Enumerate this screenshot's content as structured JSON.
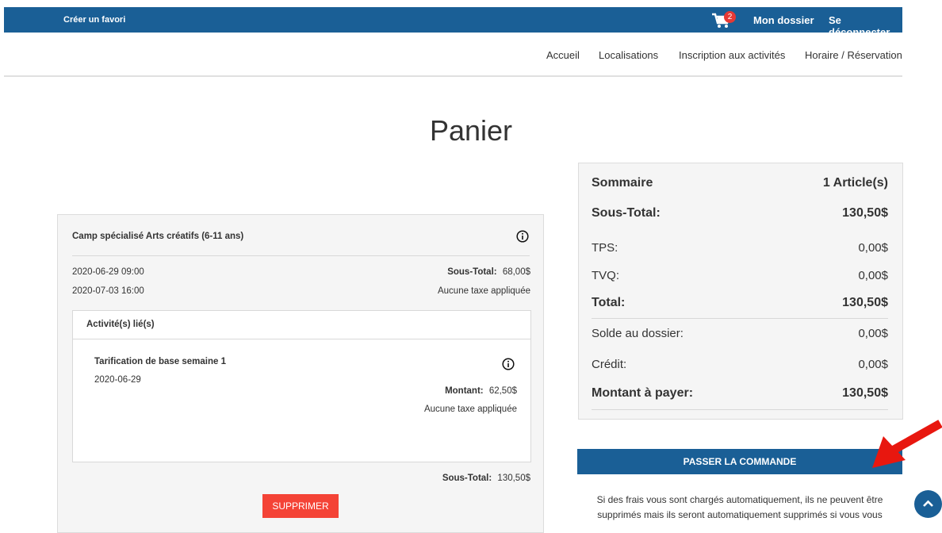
{
  "topbar": {
    "bookmark_label": "Créer un favori",
    "cart_count": "2",
    "my_account": "Mon dossier",
    "logout": "Se déconnecter"
  },
  "nav": {
    "items": [
      "Accueil",
      "Localisations",
      "Inscription aux activités",
      "Horaire / Réservation"
    ]
  },
  "page_title": "Panier",
  "cart_item": {
    "title": "Camp spécialisé Arts créatifs (6-11 ans)",
    "start": "2020-06-29 09:00",
    "end": "2020-07-03 16:00",
    "subtotal_label": "Sous-Total:",
    "subtotal_value": "68,00$",
    "tax_note": "Aucune taxe appliquée",
    "linked_header": "Activité(s) lié(s)",
    "linked": {
      "title": "Tarification de base semaine 1",
      "date": "2020-06-29",
      "amount_label": "Montant:",
      "amount_value": "62,50$",
      "tax_note": "Aucune taxe appliquée"
    },
    "total_label": "Sous-Total:",
    "total_value": "130,50$",
    "delete_label": "SUPPRIMER"
  },
  "summary": {
    "rows": [
      {
        "label": "Sommaire",
        "value": "1 Article(s)"
      },
      {
        "label": "Sous-Total:",
        "value": "130,50$"
      },
      {
        "label": "TPS:",
        "value": "0,00$"
      },
      {
        "label": "TVQ:",
        "value": "0,00$"
      },
      {
        "label": "Total:",
        "value": "130,50$"
      },
      {
        "label": "Solde au dossier:",
        "value": "0,00$"
      },
      {
        "label": "Crédit:",
        "value": "0,00$"
      },
      {
        "label": "Montant à payer:",
        "value": "130,50$"
      }
    ],
    "order_button": "PASSER LA COMMANDE",
    "note": "Si des frais vous sont chargés automatiquement, ils ne peuvent être supprimés mais ils seront automatiquement supprimés si vous vous"
  },
  "colors": {
    "primary": "#1a5f96",
    "danger": "#f44336",
    "badge": "#e53935",
    "arrow": "#e8170f"
  }
}
